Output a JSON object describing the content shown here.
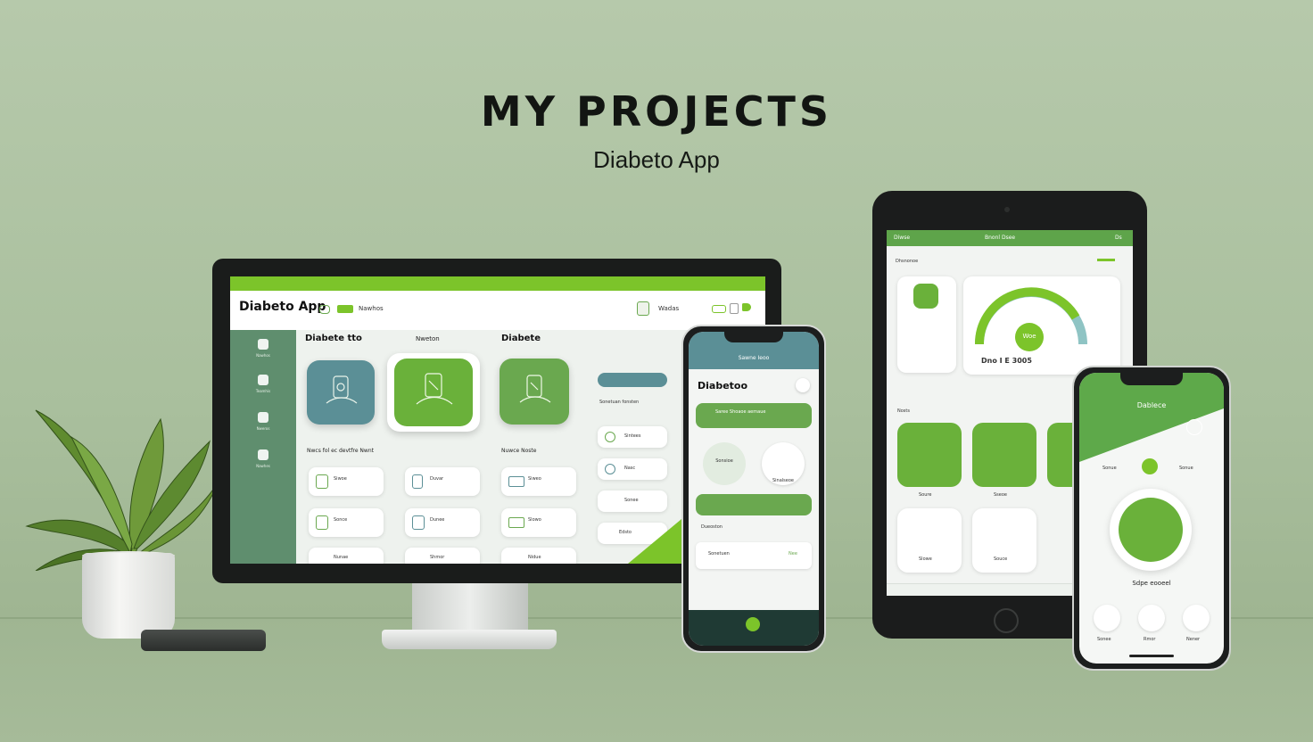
{
  "header": {
    "title": "MY PROJECTS",
    "subtitle": "Diabeto App"
  },
  "desktop": {
    "brand": "Diabeto App",
    "header_tab": "Nawhos",
    "header_right_label": "Wadas",
    "section_titles": [
      "Diabete tto",
      "Nweton",
      "Diabete"
    ],
    "subsection_titles": [
      "Nwcs fol ec devtfre Nwnt",
      "Nuwce Noste"
    ],
    "side_items": [
      "Nawhos",
      "Teamhis",
      "Nweros",
      "Nawhes"
    ],
    "cards": [
      "Siwoe",
      "Duvar",
      "Siweo",
      "Sonce",
      "Dunee",
      "Slowo",
      "Nunae",
      "Shmor",
      "Nidue"
    ],
    "right_panel_title": "Sonetuan fonsten",
    "right_panel_items": [
      "Sintees",
      "Nasc",
      "Sonee",
      "Edsto"
    ],
    "colors": {
      "accent": "#7cc42a",
      "sidebar": "#5f8e6e",
      "teal": "#5b8f96",
      "green": "#6aa84f"
    }
  },
  "phone_left": {
    "top_label": "Sawne Ieoo",
    "title": "Diabetoo",
    "card1": "Saree Shoaoe aemaue",
    "card2": "Sonsioe",
    "card3": "Sinalseoe",
    "list_title": "Dueoston",
    "list_item": "Sonetuen",
    "list_value": "Nee"
  },
  "tablet": {
    "top_left": "Diwse",
    "top_center": "Bnonl Dsee",
    "top_right": "Ds",
    "section": "Dhsnonoe",
    "gauge_value": "Woe",
    "gauge_readout": "Dno   I E 3005",
    "grid_title": "Nosts",
    "grid_labels": [
      "Soure",
      "Sseoe",
      "Slowe",
      "Souce"
    ]
  },
  "phone_right": {
    "title": "Dablece",
    "stat_left": "Sonue",
    "stat_right": "Sonue",
    "caption": "Sdpe eooeel",
    "bottom_labels": [
      "Sonee",
      "Rmor",
      "Nener"
    ]
  }
}
